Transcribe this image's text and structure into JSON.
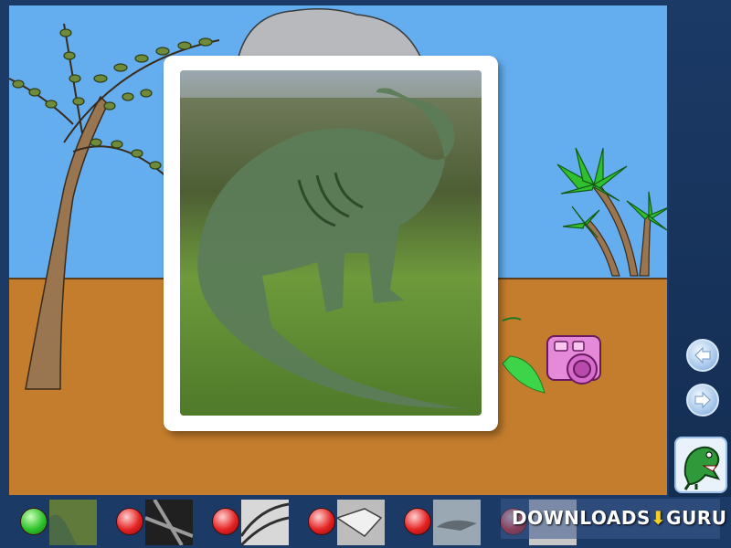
{
  "navigation": {
    "back_icon": "arrow-left-icon",
    "forward_icon": "arrow-right-icon"
  },
  "scene": {
    "sky_color": "#64aef0",
    "ground_color": "#c47d2c",
    "photo_subject": "dinosaur-silhouette-icon",
    "camera_icon": "camera-icon",
    "mascot_icon": "dinosaur-mascot-icon"
  },
  "toolbar": {
    "slots": [
      {
        "dot": "green",
        "thumb": "thumb-1"
      },
      {
        "dot": "red",
        "thumb": "thumb-2"
      },
      {
        "dot": "red",
        "thumb": "thumb-3"
      },
      {
        "dot": "red",
        "thumb": "thumb-4"
      },
      {
        "dot": "red",
        "thumb": "thumb-5"
      },
      {
        "dot": "red",
        "thumb": "thumb-6"
      }
    ]
  },
  "watermark": {
    "left": "DOWNLOADS",
    "right": "GURU"
  }
}
